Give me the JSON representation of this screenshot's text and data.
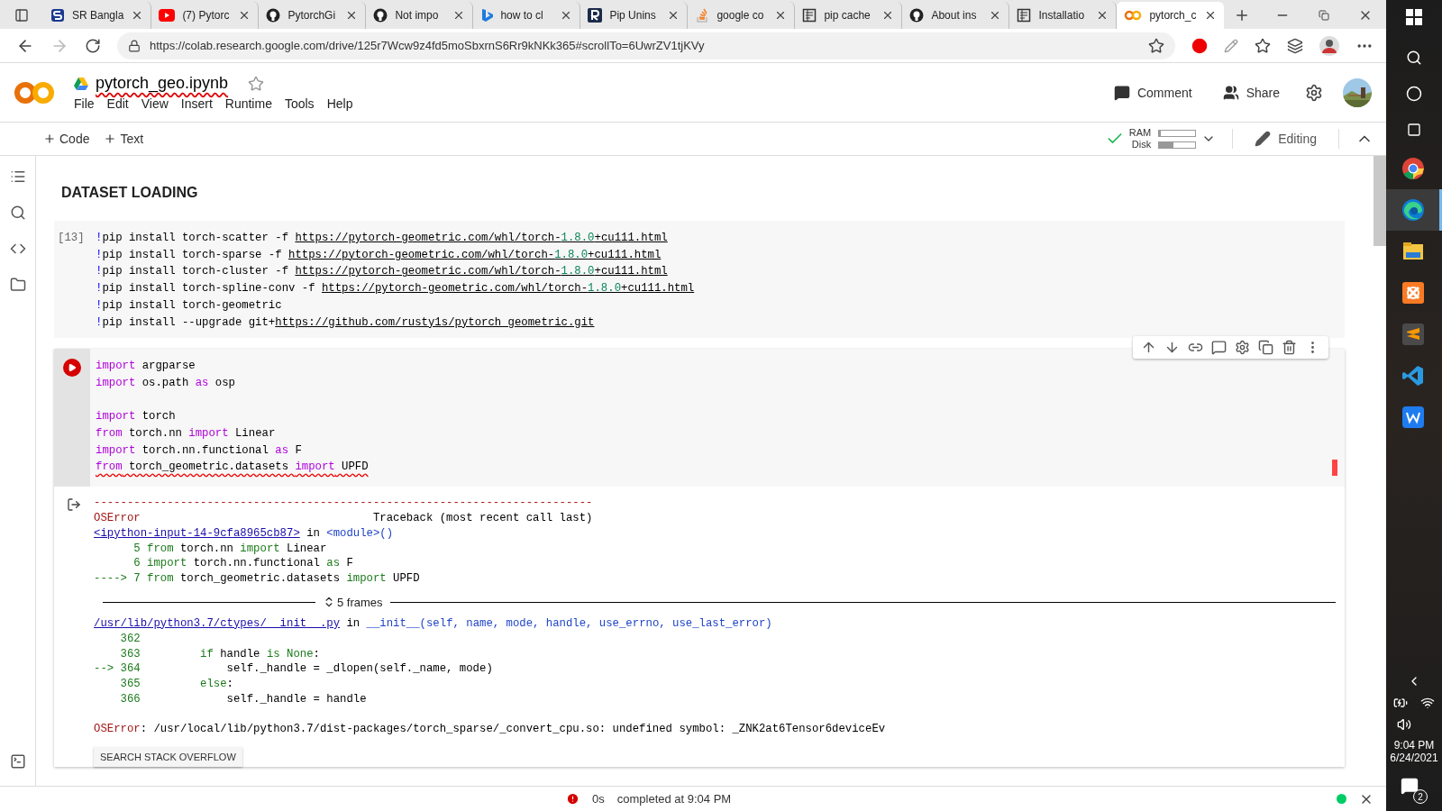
{
  "browser": {
    "tabs": [
      {
        "title": "SR Bangla",
        "kind": "s",
        "selected": false
      },
      {
        "title": "(7) Pytorc",
        "kind": "youtube",
        "selected": false
      },
      {
        "title": "PytorchGi",
        "kind": "github",
        "selected": false
      },
      {
        "title": "Not impo",
        "kind": "github",
        "selected": false
      },
      {
        "title": "how to cl",
        "kind": "bing",
        "selected": false
      },
      {
        "title": "Pip Unins",
        "kind": "r",
        "selected": false
      },
      {
        "title": "google co",
        "kind": "stack",
        "selected": false
      },
      {
        "title": "pip cache",
        "kind": "doc",
        "selected": false
      },
      {
        "title": "About ins",
        "kind": "github",
        "selected": false
      },
      {
        "title": "Installatio",
        "kind": "doc",
        "selected": false
      },
      {
        "title": "pytorch_c",
        "kind": "colab",
        "selected": true
      }
    ],
    "url": "https://colab.research.google.com/drive/125r7Wcw9z4fd5moSbxrnS6Rr9kNKk365#scrollTo=6UwrZV1tjKVy"
  },
  "colab": {
    "notebook_title": "pytorch_geo.ipynb",
    "starred": false,
    "menu": [
      "File",
      "Edit",
      "View",
      "Insert",
      "Runtime",
      "Tools",
      "Help"
    ],
    "actions": [
      "Comment",
      "Share"
    ],
    "add_buttons": [
      "Code",
      "Text"
    ],
    "resources": [
      {
        "label": "RAM",
        "level": 0.05
      },
      {
        "label": "Disk",
        "level": 0.4
      }
    ],
    "connected": true,
    "mode": "Editing"
  },
  "notebook": {
    "heading": "DATASET LOADING",
    "cell_1": {
      "execution_count": "[13]",
      "lines": [
        [
          {
            "kind": "bang",
            "text": "!"
          },
          {
            "kind": "p",
            "text": "pip install torch-scatter -f "
          },
          {
            "kind": "link",
            "parts": [
              {
                "kind": "p",
                "text": "https://pytorch-geometric.com/whl/torch-"
              },
              {
                "kind": "num",
                "text": "1.8.0"
              },
              {
                "kind": "p",
                "text": "+cu111.html"
              }
            ]
          }
        ],
        [
          {
            "kind": "bang",
            "text": "!"
          },
          {
            "kind": "p",
            "text": "pip install torch-sparse -f "
          },
          {
            "kind": "link",
            "parts": [
              {
                "kind": "p",
                "text": "https://pytorch-geometric.com/whl/torch-"
              },
              {
                "kind": "num",
                "text": "1.8.0"
              },
              {
                "kind": "p",
                "text": "+cu111.html"
              }
            ]
          }
        ],
        [
          {
            "kind": "bang",
            "text": "!"
          },
          {
            "kind": "p",
            "text": "pip install torch-cluster -f "
          },
          {
            "kind": "link",
            "parts": [
              {
                "kind": "p",
                "text": "https://pytorch-geometric.com/whl/torch-"
              },
              {
                "kind": "num",
                "text": "1.8.0"
              },
              {
                "kind": "p",
                "text": "+cu111.html"
              }
            ]
          }
        ],
        [
          {
            "kind": "bang",
            "text": "!"
          },
          {
            "kind": "p",
            "text": "pip install torch-spline-conv -f "
          },
          {
            "kind": "link",
            "parts": [
              {
                "kind": "p",
                "text": "https://pytorch-geometric.com/whl/torch-"
              },
              {
                "kind": "num",
                "text": "1.8.0"
              },
              {
                "kind": "p",
                "text": "+cu111.html"
              }
            ]
          }
        ],
        [
          {
            "kind": "bang",
            "text": "!"
          },
          {
            "kind": "p",
            "text": "pip install torch-geometric"
          }
        ],
        [
          {
            "kind": "bang",
            "text": "!"
          },
          {
            "kind": "p",
            "text": "pip install --upgrade git+"
          },
          {
            "kind": "link",
            "text": "https://github.com/rusty1s/pytorch_geometric.git"
          }
        ]
      ]
    },
    "cell_2": {
      "error": true,
      "blocks": [
        [
          {
            "squiggle": false,
            "tokens": [
              {
                "kind": "kw",
                "text": "import"
              },
              {
                "kind": "p",
                "text": " argparse"
              }
            ]
          },
          {
            "squiggle": false,
            "tokens": [
              {
                "kind": "kw",
                "text": "import"
              },
              {
                "kind": "p",
                "text": " os.path "
              },
              {
                "kind": "kw",
                "text": "as"
              },
              {
                "kind": "p",
                "text": " osp"
              }
            ]
          }
        ],
        [
          {
            "squiggle": false,
            "tokens": [
              {
                "kind": "kw",
                "text": "import"
              },
              {
                "kind": "p",
                "text": " torch"
              }
            ]
          },
          {
            "squiggle": false,
            "tokens": [
              {
                "kind": "kw",
                "text": "from"
              },
              {
                "kind": "p",
                "text": " torch.nn "
              },
              {
                "kind": "kw",
                "text": "import"
              },
              {
                "kind": "p",
                "text": " Linear"
              }
            ]
          },
          {
            "squiggle": false,
            "tokens": [
              {
                "kind": "kw",
                "text": "import"
              },
              {
                "kind": "p",
                "text": " torch.nn.functional "
              },
              {
                "kind": "kw",
                "text": "as"
              },
              {
                "kind": "p",
                "text": " F"
              }
            ]
          },
          {
            "squiggle": true,
            "tokens": [
              {
                "kind": "kw",
                "text": "from"
              },
              {
                "kind": "p",
                "text": " torch_geometric.datasets "
              },
              {
                "kind": "kw",
                "text": "import"
              },
              {
                "kind": "p",
                "text": " UPFD"
              }
            ]
          }
        ]
      ],
      "output": {
        "lines": [
          [
            {
              "kind": "red",
              "text": "---------------------------------------------------------------------------"
            }
          ],
          [
            {
              "kind": "red",
              "text": "OSError"
            },
            {
              "kind": "p",
              "text": "                                   Traceback (most recent call last)"
            }
          ],
          [
            {
              "kind": "link",
              "text": "<ipython-input-14-9cfa8965cb87>"
            },
            {
              "kind": "p",
              "text": " in "
            },
            {
              "kind": "blue",
              "text": "<module>()"
            }
          ],
          [
            {
              "kind": "grn",
              "text": "      5 from"
            },
            {
              "kind": "p",
              "text": " torch.nn "
            },
            {
              "kind": "grn",
              "text": "import"
            },
            {
              "kind": "p",
              "text": " Linear"
            }
          ],
          [
            {
              "kind": "grn",
              "text": "      6 import"
            },
            {
              "kind": "p",
              "text": " torch.nn.functional "
            },
            {
              "kind": "grn",
              "text": "as"
            },
            {
              "kind": "p",
              "text": " F"
            }
          ],
          [
            {
              "kind": "grn",
              "text": "----> 7 from"
            },
            {
              "kind": "p",
              "text": " torch_geometric.datasets "
            },
            {
              "kind": "grn",
              "text": "import"
            },
            {
              "kind": "p",
              "text": " UPFD"
            }
          ]
        ],
        "frames": "5 frames",
        "frame_lines": [
          [
            {
              "kind": "link",
              "text": "/usr/lib/python3.7/ctypes/__init__.py"
            },
            {
              "kind": "p",
              "text": " in "
            },
            {
              "kind": "blue",
              "text": "__init__(self, name, mode, handle, use_errno, use_last_error)"
            }
          ],
          [
            {
              "kind": "grn",
              "text": "    362"
            }
          ],
          [
            {
              "kind": "grn",
              "text": "    363         if"
            },
            {
              "kind": "p",
              "text": " handle "
            },
            {
              "kind": "grn",
              "text": "is None"
            },
            {
              "kind": "p",
              "text": ":"
            }
          ],
          [
            {
              "kind": "grn",
              "text": "--> 364"
            },
            {
              "kind": "p",
              "text": "             self._handle = _dlopen(self._name, mode)"
            }
          ],
          [
            {
              "kind": "grn",
              "text": "    365         else"
            },
            {
              "kind": "p",
              "text": ":"
            }
          ],
          [
            {
              "kind": "grn",
              "text": "    366"
            },
            {
              "kind": "p",
              "text": "             self._handle = handle"
            }
          ]
        ],
        "error_line": [
          {
            "kind": "red",
            "text": "OSError"
          },
          {
            "kind": "p",
            "text": ": /usr/local/lib/python3.7/dist-packages/torch_sparse/_convert_cpu.so: undefined symbol: _ZNK2at6Tensor6deviceEv"
          }
        ],
        "button": "SEARCH STACK OVERFLOW"
      }
    }
  },
  "status_bar": {
    "error": true,
    "duration": "0s",
    "message": "completed at 9:04 PM",
    "connected": true
  },
  "taskbar": {
    "apps": [
      {
        "kind": "chrome",
        "active": false
      },
      {
        "kind": "edge",
        "active": true
      },
      {
        "kind": "explorer",
        "active": false
      },
      {
        "kind": "xampp",
        "active": false
      },
      {
        "kind": "sublime",
        "active": false
      },
      {
        "kind": "vscode",
        "active": false
      },
      {
        "kind": "wps",
        "active": false
      }
    ],
    "time": "9:04 PM",
    "date": "6/24/2021",
    "notifications": "2"
  }
}
